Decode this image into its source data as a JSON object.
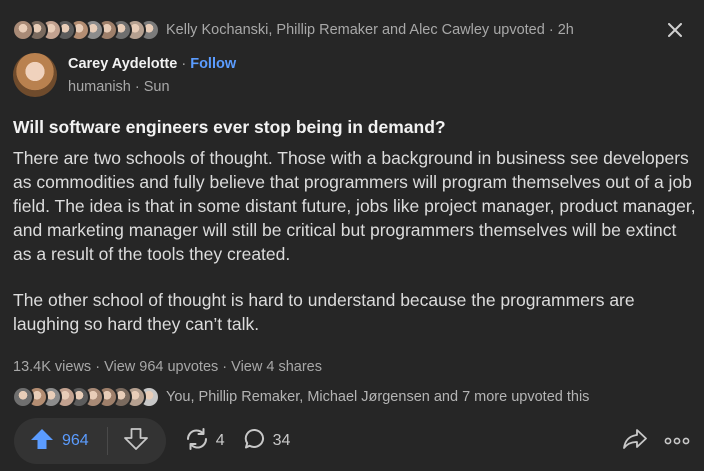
{
  "colors": {
    "background": "#262626",
    "accent": "#5b9cff",
    "muted": "#a8a8a8",
    "text": "#dcdcdc"
  },
  "top_upvoters": {
    "avatars": [
      "#a88a76",
      "#7a6a5e",
      "#c2a290",
      "#5c5c5c",
      "#b38d72",
      "#8c8c8c",
      "#9e7f6a",
      "#6f6f6f",
      "#b5a090",
      "#7b7b7b"
    ],
    "text": "Kelly Kochanski, Phillip Remaker and Alec Cawley upvoted",
    "separator": " · ",
    "time": "2h"
  },
  "author": {
    "name": "Carey Aydelotte",
    "separator": " · ",
    "follow_label": "Follow",
    "profile": "humanish",
    "date_separator": " · ",
    "date": "Sun"
  },
  "question": "Will software engineers ever stop being in demand?",
  "answer": {
    "paragraphs": [
      "There are two schools of thought. Those with a background in business see developers as commodities and fully believe that programmers will program themselves out of a job field. The idea is that in some distant future, jobs like project manager, product manager, and marketing manager will still be critical but programmers themselves will be extinct as a result of the tools they created.",
      "The other school of thought is hard to understand because the programmers are laughing so hard they can’t talk."
    ]
  },
  "stats": {
    "views": "13.4K views",
    "sep1": " · ",
    "upvotes_link": "View 964 upvotes",
    "sep2": " · ",
    "shares_link": "View 4 shares"
  },
  "upvoters": {
    "avatars": [
      "#6f6f6f",
      "#b38d72",
      "#8c8c8c",
      "#c2a290",
      "#5c5c5c",
      "#a88a76",
      "#9e7f6a",
      "#7a6a5e",
      "#b5a090",
      "#c7c7c7"
    ],
    "text": "You, Phillip Remaker, Michael Jørgensen and 7 more upvoted this"
  },
  "actions": {
    "upvote_count": "964",
    "reshare_count": "4",
    "comment_count": "34"
  }
}
